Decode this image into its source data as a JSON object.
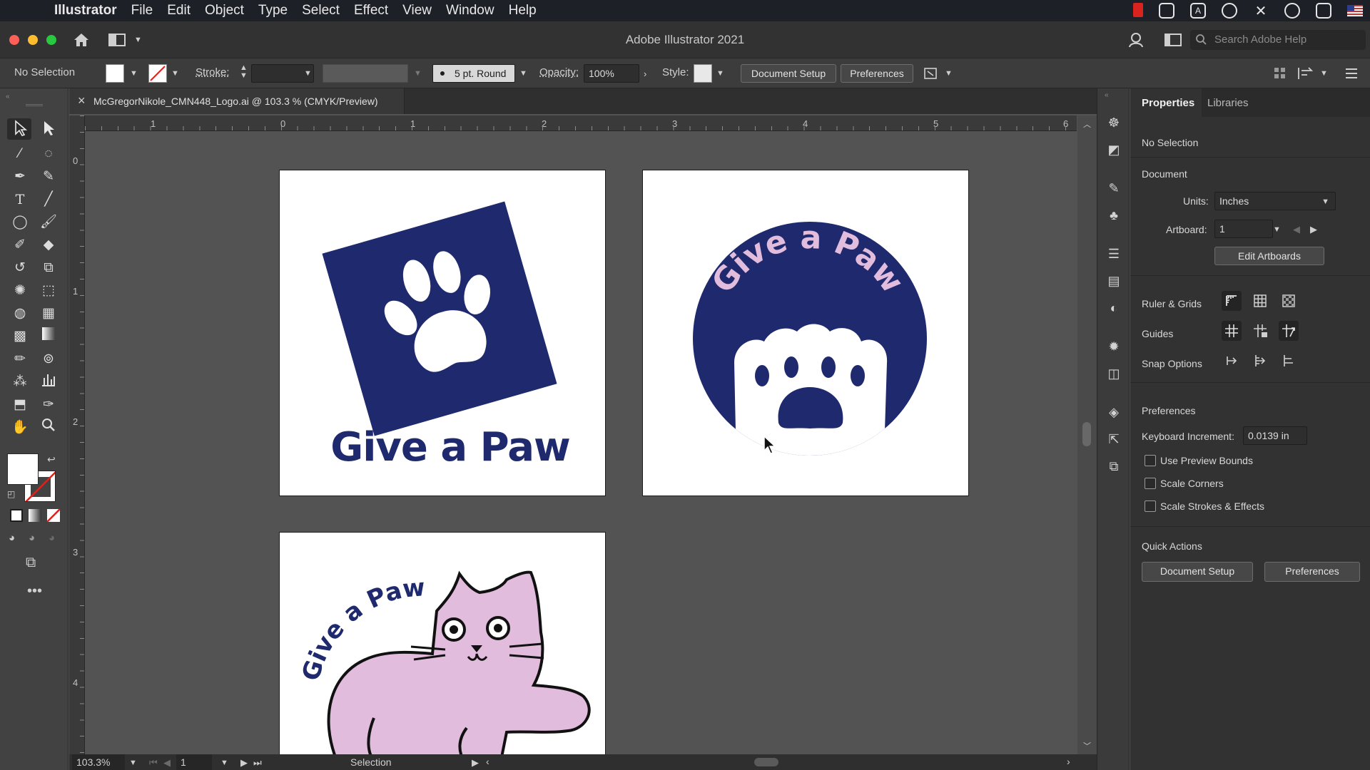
{
  "menubar": {
    "app_name": "Illustrator",
    "items": [
      "File",
      "Edit",
      "Object",
      "Type",
      "Select",
      "Effect",
      "View",
      "Window",
      "Help"
    ]
  },
  "window": {
    "title": "Adobe Illustrator 2021",
    "search_placeholder": "Search Adobe Help"
  },
  "control_bar": {
    "selection_label": "No Selection",
    "stroke_label": "Stroke:",
    "brush_label": "5 pt. Round",
    "opacity_label": "Opacity:",
    "opacity_value": "100%",
    "style_label": "Style:",
    "document_setup": "Document Setup",
    "preferences": "Preferences"
  },
  "document": {
    "tab_title": "McGregorNikole_CMN448_Logo.ai @ 103.3 % (CMYK/Preview)",
    "close_glyph": "×"
  },
  "rulers": {
    "horizontal": [
      "1",
      "0",
      "1",
      "2",
      "3",
      "4",
      "5",
      "6"
    ],
    "vertical": [
      "0",
      "1",
      "2",
      "3",
      "4"
    ]
  },
  "artwork": {
    "logo1_text": "Give a Paw",
    "logo2_text": "Give a Paw",
    "logo3_text": "Give a Paw",
    "navy": "#1f2a6e",
    "pink": "#e2bcdc"
  },
  "panel": {
    "tabs": [
      "Properties",
      "Libraries"
    ],
    "selection": "No Selection",
    "document_heading": "Document",
    "units_label": "Units:",
    "units_value": "Inches",
    "artboard_label": "Artboard:",
    "artboard_value": "1",
    "edit_artboards": "Edit Artboards",
    "ruler_grids": "Ruler & Grids",
    "guides": "Guides",
    "snap_options": "Snap Options",
    "preferences_heading": "Preferences",
    "keyboard_increment_label": "Keyboard Increment:",
    "keyboard_increment_value": "0.0139 in",
    "checkboxes": [
      "Use Preview Bounds",
      "Scale Corners",
      "Scale Strokes & Effects"
    ],
    "quick_actions": "Quick Actions",
    "quick_document_setup": "Document Setup",
    "quick_preferences": "Preferences"
  },
  "status_bar": {
    "zoom": "103.3%",
    "artboard_number": "1",
    "tool_name": "Selection"
  }
}
